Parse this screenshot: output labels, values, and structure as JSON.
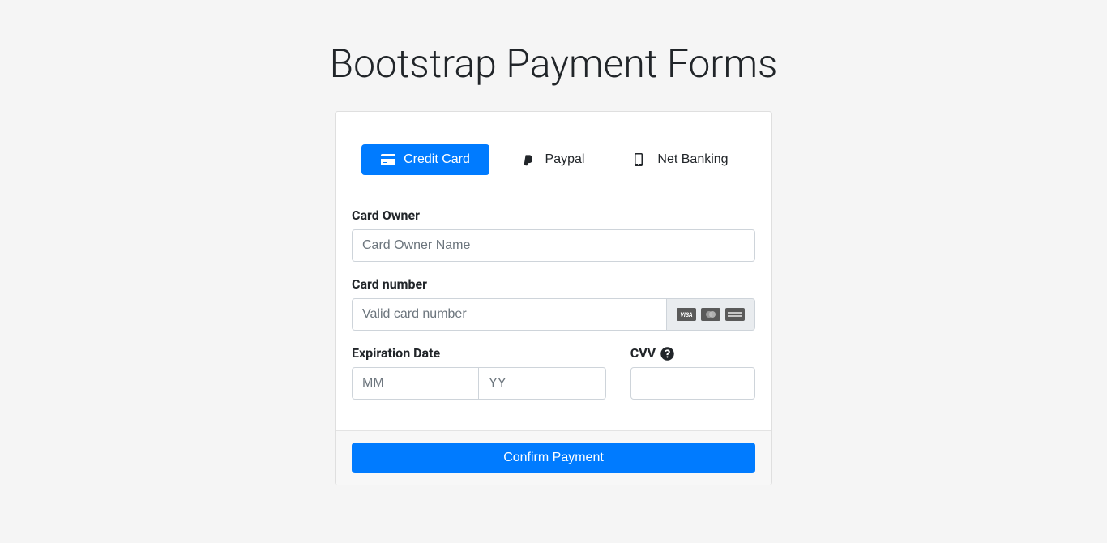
{
  "title": "Bootstrap Payment Forms",
  "tabs": {
    "credit_card": "Credit Card",
    "paypal": "Paypal",
    "net_banking": "Net Banking"
  },
  "form": {
    "card_owner_label": "Card Owner",
    "card_owner_placeholder": "Card Owner Name",
    "card_number_label": "Card number",
    "card_number_placeholder": "Valid card number",
    "expiration_label": "Expiration Date",
    "exp_month_placeholder": "MM",
    "exp_year_placeholder": "YY",
    "cvv_label": "CVV",
    "confirm_button": "Confirm Payment"
  }
}
